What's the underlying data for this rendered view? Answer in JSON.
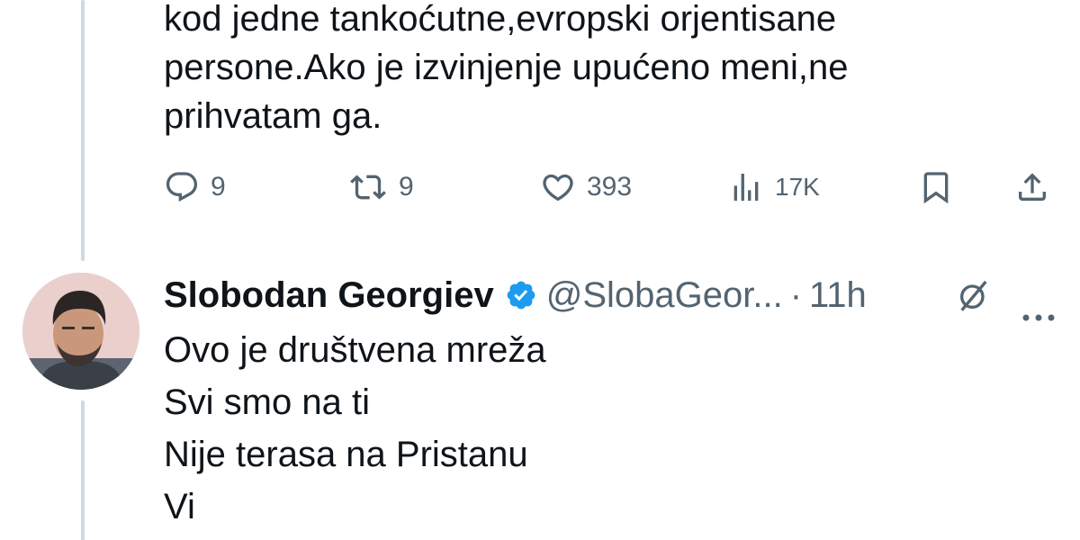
{
  "previous_tweet": {
    "text_lines": [
      "kod jedne tankoćutne,evropski orjentisane",
      "persone.Ako je izvinjenje upućeno meni,ne",
      "prihvatam ga."
    ],
    "actions": {
      "replies": "9",
      "reposts": "9",
      "likes": "393",
      "views": "17K"
    },
    "icons": {
      "reply": "reply-icon",
      "repost": "repost-icon",
      "like": "heart-icon",
      "views": "views-icon",
      "bookmark": "bookmark-icon",
      "share": "share-icon"
    }
  },
  "reply_tweet": {
    "author_name": "Slobodan Georgiev",
    "handle": "@SlobaGeor...",
    "separator": "·",
    "timestamp": "11h",
    "text_lines": [
      "Ovo je društvena mreža",
      "Svi smo na ti",
      "Nije terasa na Pristanu",
      "Vi"
    ],
    "icons": {
      "verified": "verified-badge-icon",
      "grok": "grok-icon",
      "more": "more-options-icon"
    }
  },
  "colors": {
    "text_primary": "#0f1419",
    "text_secondary": "#536471",
    "verified_blue": "#1d9bf0",
    "thread_line": "#cfd9de"
  }
}
